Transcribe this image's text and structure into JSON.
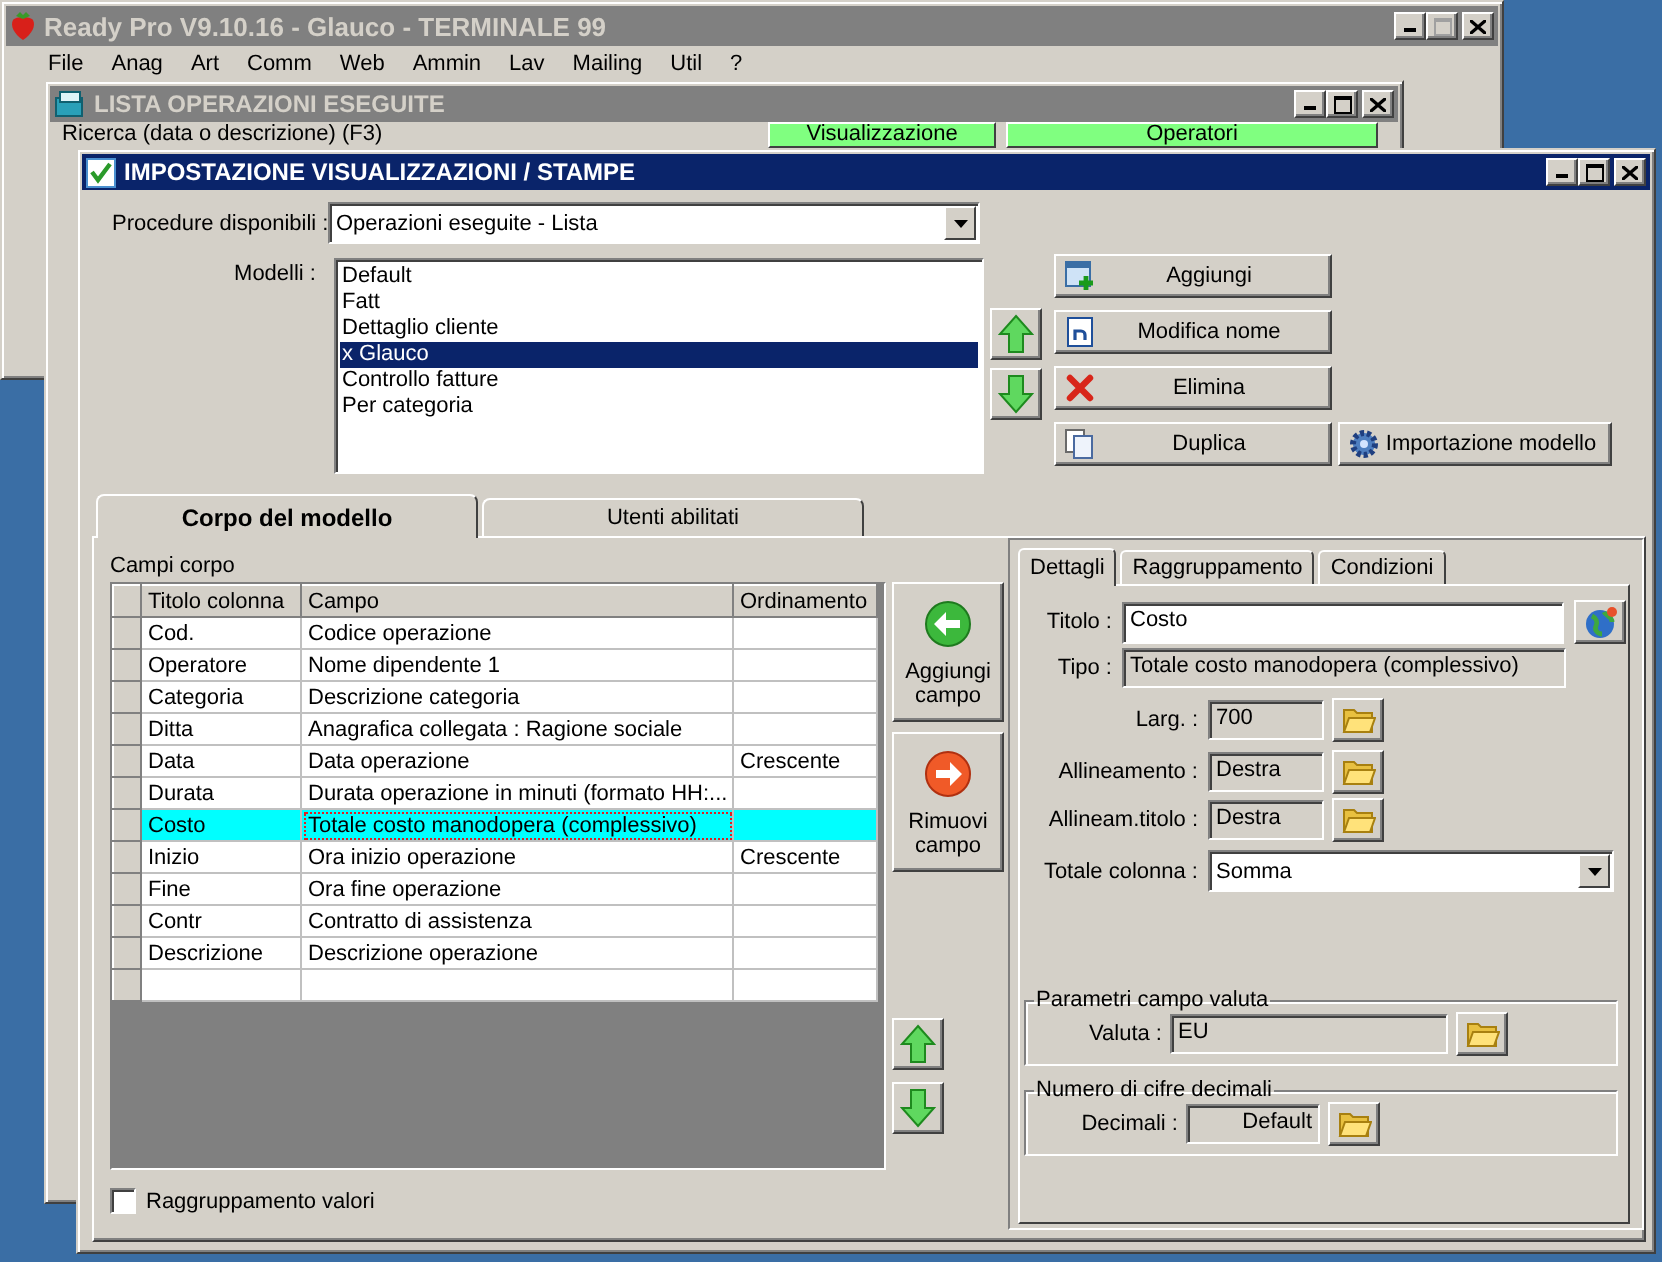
{
  "background_windows": [
    {
      "title": "Ready Pro V9.10.16 - Glauco - TERMINALE 99",
      "kind": "main",
      "caption_buttons": [
        {
          "kind": "minimize",
          "disabled": false
        },
        {
          "kind": "maximize",
          "disabled": true
        },
        {
          "kind": "close",
          "disabled": false
        }
      ],
      "menu": [
        "File",
        "Anag",
        "Art",
        "Comm",
        "Web",
        "Ammin",
        "Lav",
        "Mailing",
        "Util",
        "?"
      ]
    },
    {
      "title": "LISTA OPERAZIONI ESEGUITE",
      "kind": "list",
      "caption_buttons": [
        {
          "kind": "minimize",
          "disabled": false
        },
        {
          "kind": "maximize",
          "disabled": false
        },
        {
          "kind": "close",
          "disabled": false
        }
      ],
      "search_label": "Ricerca (data o descrizione) (F3)",
      "buttons": [
        "Visualizzazione",
        "Operatori"
      ]
    }
  ],
  "dialog": {
    "title": "IMPOSTAZIONE VISUALIZZAZIONI / STAMPE",
    "caption_buttons": [
      {
        "kind": "minimize",
        "disabled": false
      },
      {
        "kind": "maximize",
        "disabled": false
      },
      {
        "kind": "close",
        "disabled": false
      }
    ],
    "procedure": {
      "label": "Procedure disponibili :",
      "value": "Operazioni eseguite - Lista"
    },
    "models": {
      "label": "Modelli :",
      "items": [
        {
          "label": "Default",
          "selected": false
        },
        {
          "label": "Fatt",
          "selected": false
        },
        {
          "label": "Dettaglio cliente",
          "selected": false
        },
        {
          "label": "x Glauco",
          "selected": true
        },
        {
          "label": "Controllo fatture",
          "selected": false
        },
        {
          "label": "Per categoria",
          "selected": false
        }
      ]
    },
    "model_buttons": [
      {
        "label": "Aggiungi",
        "kind": "add"
      },
      {
        "label": "Modifica nome",
        "kind": "rename"
      },
      {
        "label": "Elimina",
        "kind": "delete"
      },
      {
        "label": "Duplica",
        "kind": "duplicate"
      },
      {
        "label": "Importazione modello",
        "kind": "import"
      }
    ],
    "tabs": [
      {
        "label": "Corpo del modello",
        "selected": true
      },
      {
        "label": "Utenti abilitati",
        "selected": false
      }
    ],
    "fields_label": "Campi corpo",
    "grid": {
      "columns": [
        "Titolo colonna",
        "Campo",
        "Ordinamento"
      ],
      "rows": [
        {
          "title": "Cod.",
          "field": "Codice operazione",
          "selected": false
        },
        {
          "title": "Operatore",
          "field": "Nome dipendente 1",
          "selected": false
        },
        {
          "title": "Categoria",
          "field": "Descrizione categoria",
          "selected": false
        },
        {
          "title": "Ditta",
          "field": "Anagrafica collegata : Ragione sociale",
          "selected": false
        },
        {
          "title": "Data",
          "field": "Data operazione",
          "order": "Crescente",
          "selected": false
        },
        {
          "title": "Durata",
          "field": "Durata operazione in minuti (formato HH:...",
          "selected": false
        },
        {
          "title": "Costo",
          "field": "Totale costo manodopera (complessivo)",
          "selected": true
        },
        {
          "title": "Inizio",
          "field": "Ora inizio operazione",
          "order": "Crescente",
          "selected": false
        },
        {
          "title": "Fine",
          "field": "Ora fine operazione",
          "selected": false
        },
        {
          "title": "Contr",
          "field": "Contratto di assistenza",
          "selected": false
        },
        {
          "title": "Descrizione",
          "field": "Descrizione operazione",
          "selected": false
        }
      ]
    },
    "field_buttons": [
      {
        "label": "Aggiungi campo",
        "kind": "add"
      },
      {
        "label": "Rimuovi campo",
        "kind": "remove"
      }
    ],
    "grouping_checkbox": {
      "label": "Raggruppamento valori",
      "checked": false
    },
    "detail_tabs": [
      {
        "label": "Dettagli",
        "selected": true
      },
      {
        "label": "Raggruppamento",
        "selected": false
      },
      {
        "label": "Condizioni",
        "selected": false
      }
    ],
    "details": [
      {
        "label": "Titolo :",
        "value": "Costo",
        "kind": "input"
      },
      {
        "label": "Tipo :",
        "value": "Totale costo manodopera (complessivo)",
        "kind": "readonly"
      },
      {
        "label": "Larg. :",
        "value": "700",
        "kind": "picker"
      },
      {
        "label": "Allineamento :",
        "value": "Destra",
        "kind": "picker"
      },
      {
        "label": "Allineam.titolo :",
        "value": "Destra",
        "kind": "picker"
      },
      {
        "label": "Totale colonna :",
        "value": "Somma",
        "kind": "combo"
      }
    ],
    "groups": [
      {
        "legend": "Parametri campo valuta",
        "label": "Valuta :",
        "value": "EU",
        "kind": "currency"
      },
      {
        "legend": "Numero di cifre decimali",
        "label": "Decimali :",
        "value": "Default",
        "kind": "decimals"
      }
    ]
  }
}
